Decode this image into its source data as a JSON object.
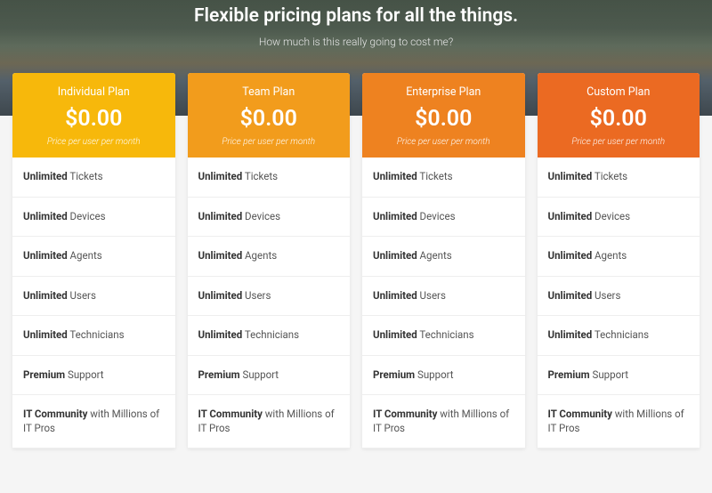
{
  "hero": {
    "title": "Flexible pricing plans for all the things.",
    "subtitle": "How much is this really going to cost me?"
  },
  "colors": {
    "plan_headers": [
      "#f7b80b",
      "#f29c1c",
      "#ee8220",
      "#eb6a22"
    ]
  },
  "plans": [
    {
      "name": "Individual Plan",
      "price": "$0.00",
      "note": "Price per user per month"
    },
    {
      "name": "Team Plan",
      "price": "$0.00",
      "note": "Price per user per month"
    },
    {
      "name": "Enterprise Plan",
      "price": "$0.00",
      "note": "Price per user per month"
    },
    {
      "name": "Custom Plan",
      "price": "$0.00",
      "note": "Price per user per month"
    }
  ],
  "features": [
    {
      "strong": "Unlimited",
      "rest": " Tickets"
    },
    {
      "strong": "Unlimited",
      "rest": " Devices"
    },
    {
      "strong": "Unlimited",
      "rest": " Agents"
    },
    {
      "strong": "Unlimited",
      "rest": " Users"
    },
    {
      "strong": "Unlimited",
      "rest": " Technicians"
    },
    {
      "strong": "Premium",
      "rest": " Support"
    },
    {
      "strong": "IT Community",
      "rest": " with Millions of IT Pros"
    }
  ]
}
